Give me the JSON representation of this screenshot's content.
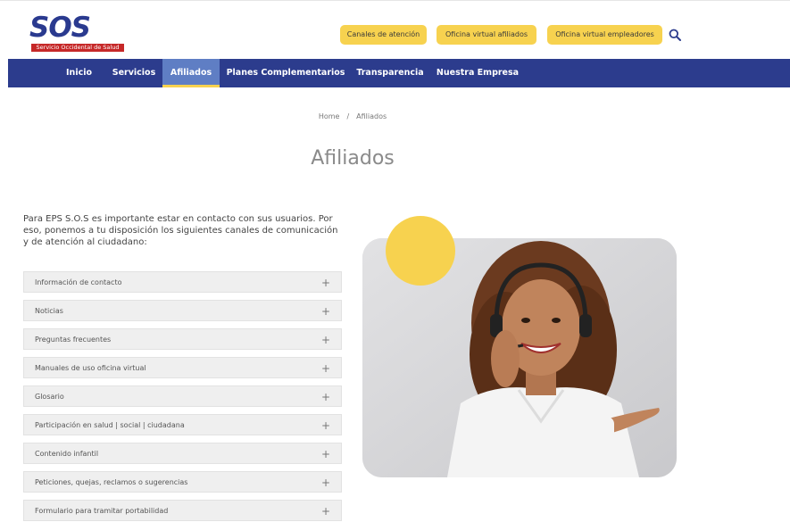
{
  "brand": {
    "logo_text": "SOS",
    "logo_tagline": "Servicio Occidental de Salud",
    "accent_yellow": "#f7d24f",
    "nav_blue": "#2c3c8d",
    "logo_red": "#c62828"
  },
  "header": {
    "buttons": [
      {
        "label": "Canales de atención"
      },
      {
        "label": "Oficina virtual afiliados"
      },
      {
        "label": "Oficina virtual empleadores"
      }
    ],
    "search_icon": "search-icon"
  },
  "nav": {
    "items": [
      {
        "label": "Inicio"
      },
      {
        "label": "Servicios"
      },
      {
        "label": "Afiliados"
      },
      {
        "label": "Planes Complementarios"
      },
      {
        "label": "Transparencia"
      },
      {
        "label": "Nuestra Empresa"
      }
    ],
    "active": "Afiliados"
  },
  "breadcrumb": {
    "home": "Home",
    "separator": "/",
    "current": "Afiliados"
  },
  "page": {
    "title": "Afiliados",
    "intro": "Para EPS S.O.S es importante estar en contacto con sus usuarios. Por eso, ponemos a tu disposición los siguientes canales de comunicación y de atención al ciudadano:"
  },
  "accordion": {
    "expand_icon": "plus-icon",
    "items": [
      {
        "label": "Información de contacto",
        "toggle": "+"
      },
      {
        "label": "Noticias",
        "toggle": "+"
      },
      {
        "label": "Preguntas frecuentes",
        "toggle": "+"
      },
      {
        "label": "Manuales de uso oficina virtual",
        "toggle": "+"
      },
      {
        "label": "Glosario",
        "toggle": "+"
      },
      {
        "label": "Participación en salud | social | ciudadana",
        "toggle": "+"
      },
      {
        "label": "Contenido infantil",
        "toggle": "+"
      },
      {
        "label": "Peticiones, quejas, reclamos o sugerencias",
        "toggle": "+"
      },
      {
        "label": "Formulario para tramitar portabilidad",
        "toggle": "+"
      }
    ]
  }
}
